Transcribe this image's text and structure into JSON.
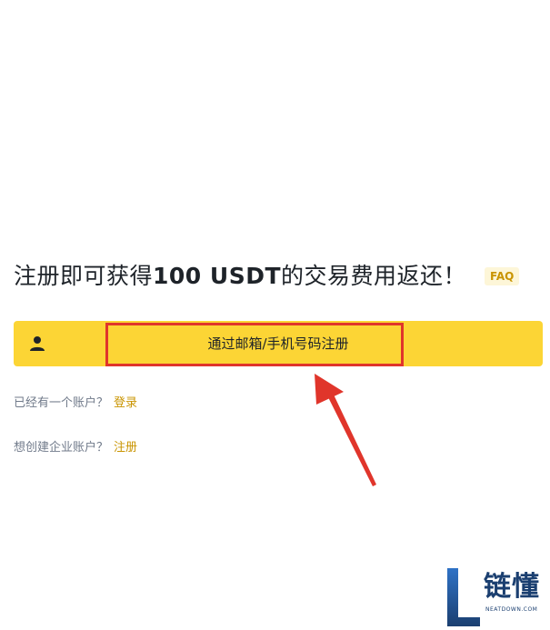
{
  "headline": {
    "prefix": "注册即可获得",
    "amount": "100 USDT",
    "suffix": "的交易费用返还！",
    "faq_label": "FAQ"
  },
  "signup": {
    "icon": "person-icon",
    "label": "通过邮箱/手机号码注册"
  },
  "login_row": {
    "text": "已经有一个账户？",
    "link": "登录"
  },
  "business_row": {
    "text": "想创建企业账户？",
    "link": "注册"
  },
  "watermark": {
    "title": "链懂",
    "subtitle": "NEATDOWN.COM"
  },
  "colors": {
    "accent_yellow": "#fcd535",
    "link_gold": "#c99400",
    "annotation_red": "#e0352b",
    "text_dark": "#1e2329",
    "text_muted": "#707a8a"
  }
}
